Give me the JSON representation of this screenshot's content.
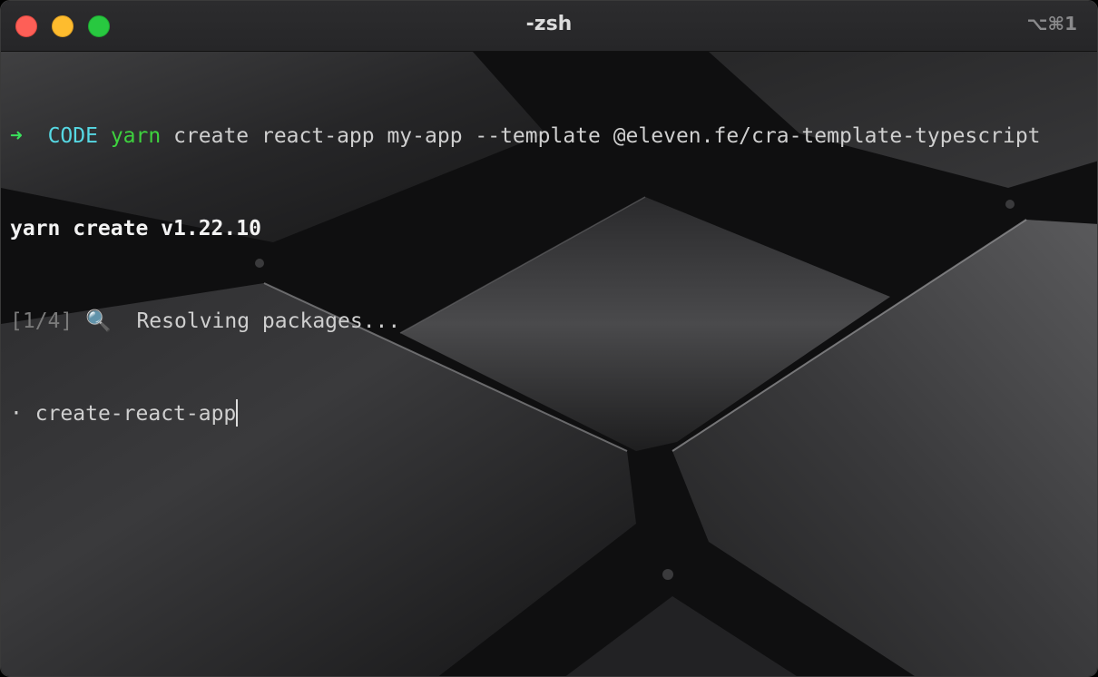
{
  "window": {
    "title": "-zsh",
    "shortcut": "⌥⌘1"
  },
  "terminal": {
    "line1": {
      "arrow": "➜",
      "dir": "CODE",
      "command": "yarn",
      "args": "create react-app my-app --template @eleven.fe/cra-template-typescript"
    },
    "line2": {
      "text": "yarn create v1.22.10"
    },
    "line3": {
      "step": "[1/4]",
      "icon": "🔍",
      "text": "Resolving packages..."
    },
    "line4": {
      "bullet": "·",
      "text": "create-react-app"
    }
  },
  "colors": {
    "close": "#fe5f57",
    "minimize": "#febc2e",
    "maximize": "#28c840",
    "prompt_arrow": "#3ae05c",
    "directory": "#56d8e3",
    "command": "#3ed23e"
  }
}
